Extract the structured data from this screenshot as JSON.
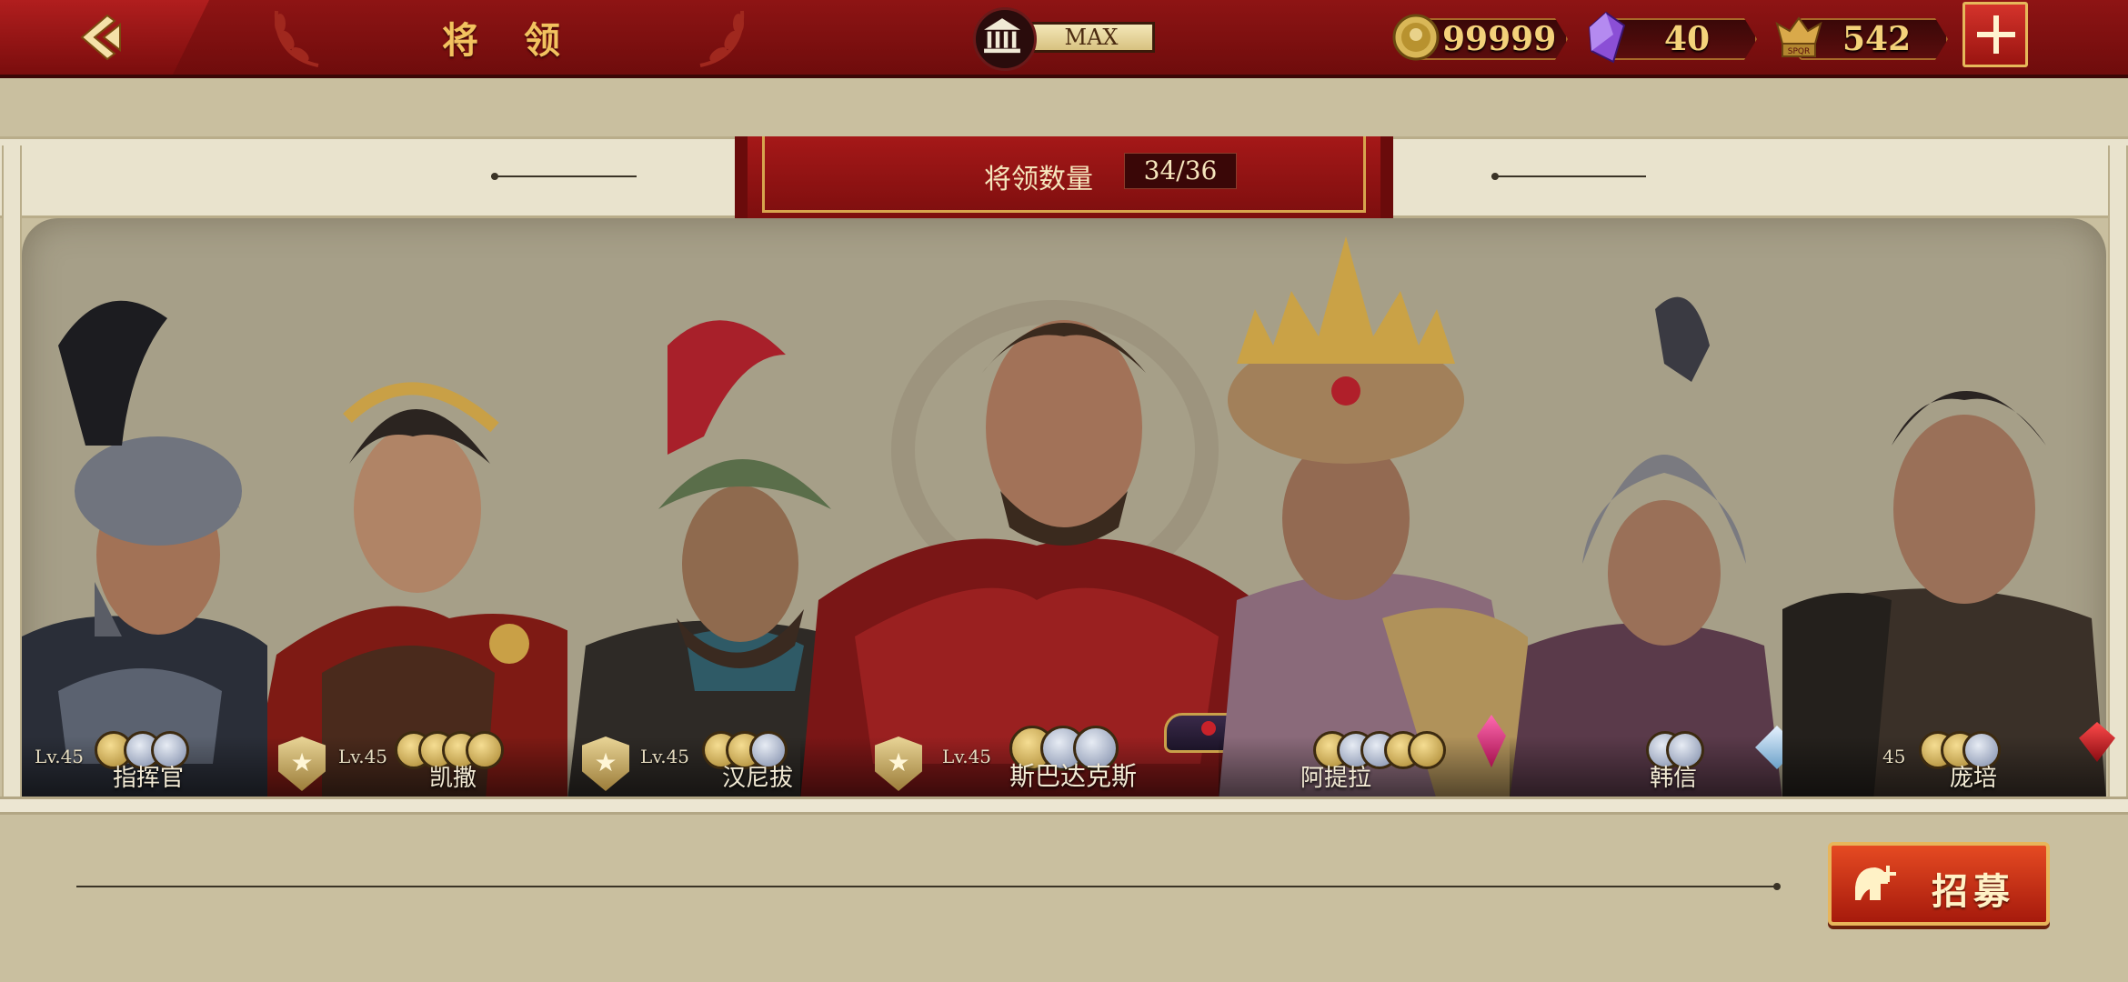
{
  "header": {
    "title": "将 领",
    "building_level": "MAX"
  },
  "resources": {
    "coins": "99999",
    "gems": "40",
    "tokens": "542"
  },
  "roster": {
    "count_label": "将领数量",
    "count_value": "34/36"
  },
  "generals": [
    {
      "name": "指挥官",
      "level": "Lv.45"
    },
    {
      "name": "凯撒",
      "level": "Lv.45"
    },
    {
      "name": "汉尼拔",
      "level": "Lv.45"
    },
    {
      "name": "斯巴达克斯",
      "level": "Lv.45"
    },
    {
      "name": "阿提拉",
      "level": ""
    },
    {
      "name": "韩信",
      "level": ""
    },
    {
      "name": "庞培",
      "level": "45"
    }
  ],
  "recruit": {
    "label": "招募"
  },
  "colors": {
    "header_red": "#8e1414",
    "gold": "#f2c25f",
    "panel": "#a69f88",
    "parchment": "#c9bf9f"
  }
}
